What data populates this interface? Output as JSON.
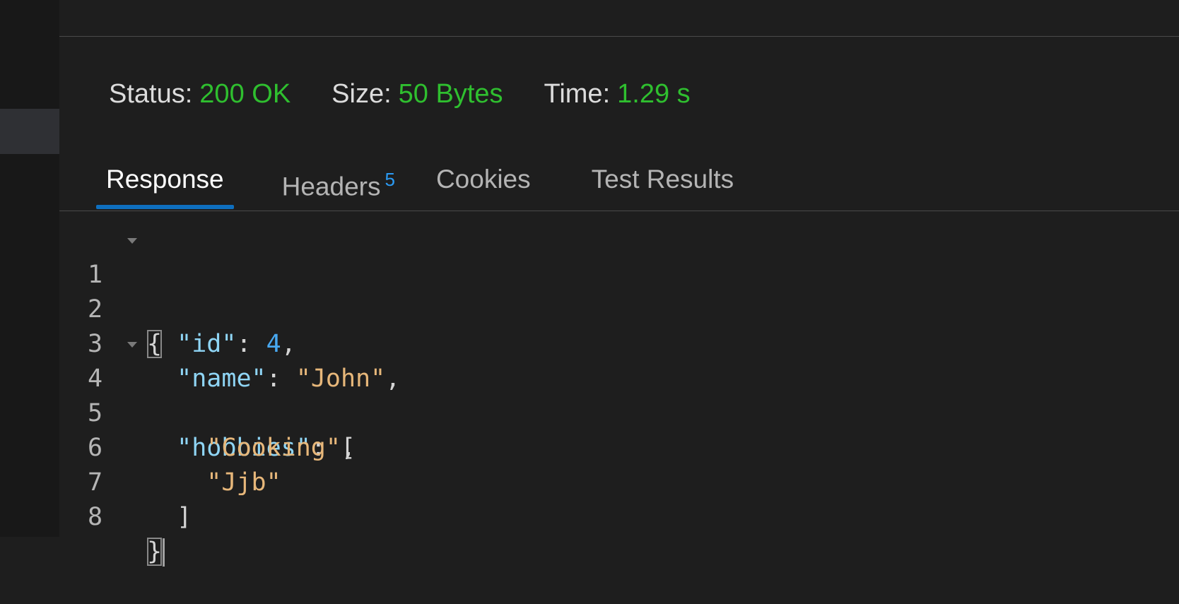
{
  "status_bar": {
    "status_label": "Status:",
    "status_value": "200 OK",
    "size_label": "Size:",
    "size_value": "50 Bytes",
    "time_label": "Time:",
    "time_value": "1.29 s"
  },
  "tabs": [
    {
      "label": "Response",
      "active": true
    },
    {
      "label": "Headers",
      "badge": "5"
    },
    {
      "label": "Cookies"
    },
    {
      "label": "Test Results"
    }
  ],
  "editor": {
    "line_numbers": [
      "1",
      "2",
      "3",
      "4",
      "5",
      "6",
      "7",
      "8"
    ],
    "line1": {
      "brace": "{"
    },
    "line2": {
      "key": "\"id\"",
      "colon": ": ",
      "value": "4",
      "comma": ","
    },
    "line3": {
      "key": "\"name\"",
      "colon": ": ",
      "value": "\"John\"",
      "comma": ","
    },
    "line4": {
      "key": "\"hobbies\"",
      "colon": ": ",
      "bracket": "["
    },
    "line5": {
      "value": "\"Cooking\"",
      "comma": ","
    },
    "line6": {
      "value": "\"Jjb\""
    },
    "line7": {
      "bracket": "]"
    },
    "line8": {
      "brace": "}"
    }
  },
  "colors": {
    "status_value": "#2fbf2f",
    "active_tab_underline": "#0e6fbf",
    "badge": "#2b9bf4",
    "json_key": "#8fd5f5",
    "json_string": "#e7b77a",
    "json_number": "#48a8f0"
  }
}
